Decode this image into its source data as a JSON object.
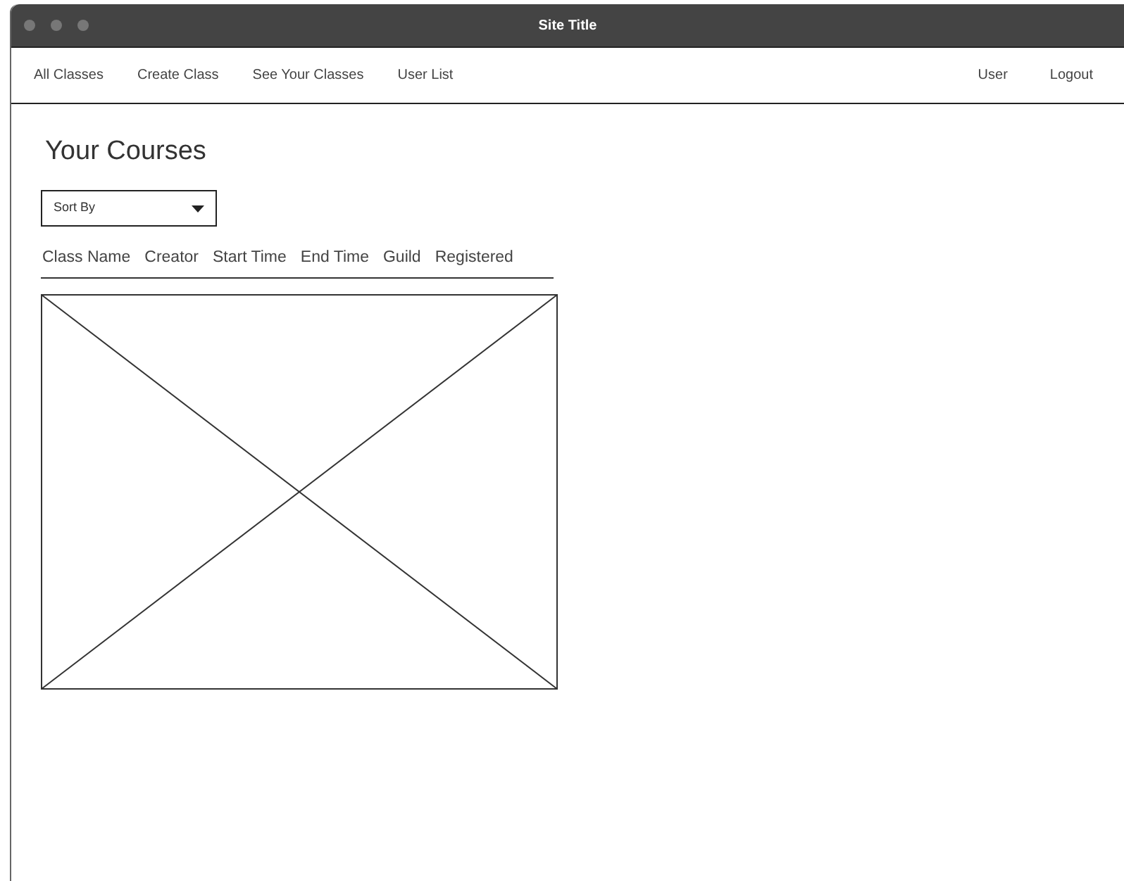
{
  "window": {
    "title": "Site Title"
  },
  "nav": {
    "items": [
      "All Classes",
      "Create Class",
      "See Your Classes",
      "User List"
    ],
    "right_items": [
      "User",
      "Logout"
    ]
  },
  "page": {
    "heading": "Your Courses",
    "sort_dropdown": {
      "label": "Sort By"
    },
    "table": {
      "columns": [
        "Class Name",
        "Creator",
        "Start Time",
        "End Time",
        "Guild",
        "Registered"
      ]
    },
    "image": {
      "kind": "placeholder"
    }
  }
}
